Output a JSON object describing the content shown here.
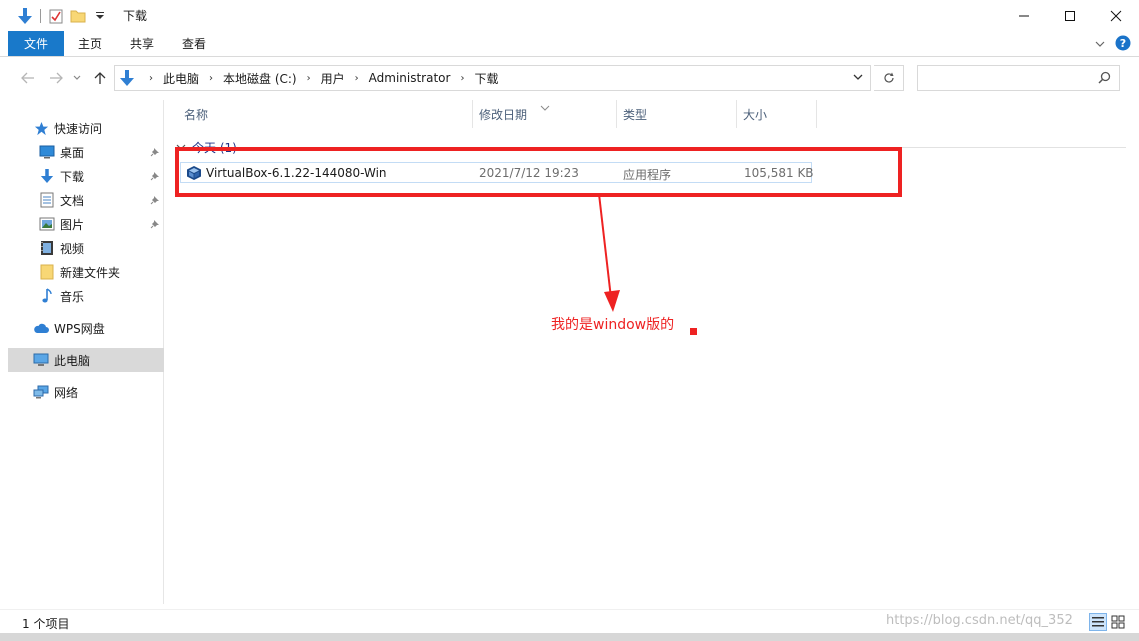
{
  "window": {
    "title": "下载"
  },
  "ribbon": {
    "tabs": [
      "文件",
      "主页",
      "共享",
      "查看"
    ]
  },
  "address": {
    "crumbs": [
      "此电脑",
      "本地磁盘 (C:)",
      "用户",
      "Administrator",
      "下载"
    ],
    "search_placeholder": ""
  },
  "sidebar": {
    "quick_access": "快速访问",
    "items": [
      {
        "label": "桌面",
        "icon": "desktop-icon",
        "pinned": true
      },
      {
        "label": "下载",
        "icon": "download-icon",
        "pinned": true
      },
      {
        "label": "文档",
        "icon": "documents-icon",
        "pinned": true
      },
      {
        "label": "图片",
        "icon": "pictures-icon",
        "pinned": true
      },
      {
        "label": "视频",
        "icon": "videos-icon",
        "pinned": false
      },
      {
        "label": "新建文件夹",
        "icon": "folder-icon",
        "pinned": false
      },
      {
        "label": "音乐",
        "icon": "music-icon",
        "pinned": false
      }
    ],
    "wps": "WPS网盘",
    "this_pc": "此电脑",
    "network": "网络"
  },
  "columns": {
    "name": "名称",
    "date": "修改日期",
    "type": "类型",
    "size": "大小"
  },
  "group": {
    "label": "今天 (1)"
  },
  "files": [
    {
      "name": "VirtualBox-6.1.22-144080-Win",
      "modified": "2021/7/12 19:23",
      "type": "应用程序",
      "size": "105,581 KB"
    }
  ],
  "annotation": {
    "text": "我的是window版的"
  },
  "status": {
    "count": "1 个项目"
  },
  "watermark": "https://blog.csdn.net/qq_352",
  "colors": {
    "accent": "#1979ca",
    "highlight": "#ee2222"
  }
}
